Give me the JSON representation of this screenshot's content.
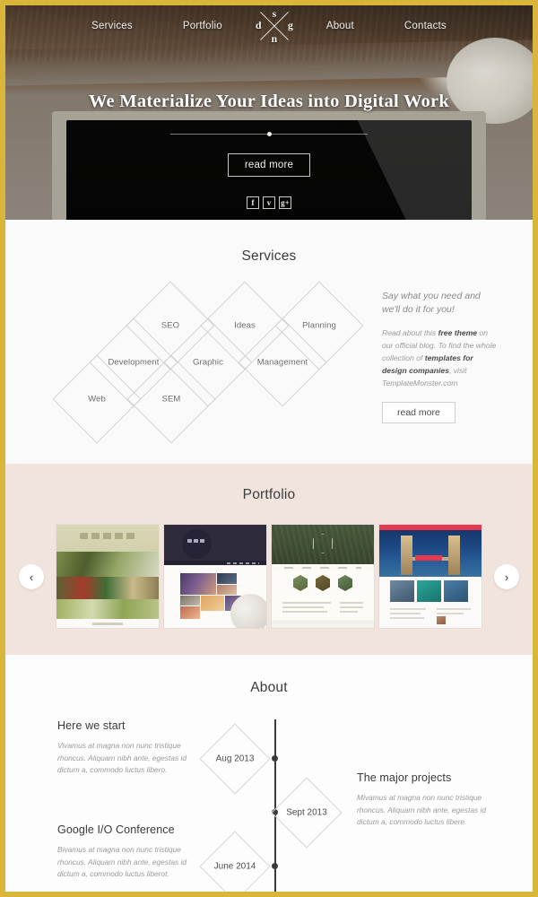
{
  "theme": {
    "frame_color": "#d9b63a",
    "portfolio_bg": "#f1e4dd",
    "page_bg": "#fbfafa",
    "accent_text": "#3c3c3c"
  },
  "nav": {
    "items": [
      {
        "label": "Services"
      },
      {
        "label": "Portfolio"
      },
      {
        "label": "About"
      },
      {
        "label": "Contacts"
      }
    ],
    "logo": {
      "letters": {
        "top": "s",
        "left": "d",
        "right": "g",
        "bottom": "n"
      }
    }
  },
  "hero": {
    "title": "We Materialize Your Ideas into Digital Work",
    "read_more": "read more",
    "social": [
      {
        "name": "facebook-icon",
        "glyph": "f"
      },
      {
        "name": "twitter-icon",
        "glyph": "ᴠ"
      },
      {
        "name": "google-plus-icon",
        "glyph": "g+"
      }
    ]
  },
  "services": {
    "title": "Services",
    "diamonds": [
      {
        "label": "SEO"
      },
      {
        "label": "Ideas"
      },
      {
        "label": "Planning"
      },
      {
        "label": "Development"
      },
      {
        "label": "Graphic"
      },
      {
        "label": "Management"
      },
      {
        "label": "Web"
      },
      {
        "label": "SEM"
      }
    ],
    "lead": "Say what you need and we'll do it for you!",
    "body_1": "Read about this ",
    "body_1_bold": "free theme",
    "body_2": " on our official blog.",
    "body_3": "To find the whole collection of ",
    "body_3_bold": "templates for design companies",
    "body_4": ", visit TemplateMonster.com",
    "read_more": "read more"
  },
  "portfolio": {
    "title": "Portfolio",
    "prev_label": "‹",
    "next_label": "›",
    "items": [
      {
        "name": "restaurant-template-thumbnail"
      },
      {
        "name": "agency-dark-template-thumbnail"
      },
      {
        "name": "green-hex-template-thumbnail"
      },
      {
        "name": "travel-london-template-thumbnail"
      }
    ]
  },
  "about": {
    "title": "About",
    "timeline": [
      {
        "date": "Aug 2013",
        "side": "left",
        "heading": "Here we start",
        "text": "Vivamus at magna non nunc tristique rhoncus. Aliquam nibh ante, egestas id dictum a, commodo luctus libero."
      },
      {
        "date": "Sept 2013",
        "side": "right",
        "heading": "The major projects",
        "text": "Mivamus at magna non nunc tristique rhoncus. Aliquam nibh ante, egestas id dictum a, commodo luctus libere."
      },
      {
        "date": "June 2014",
        "side": "left",
        "heading": "Google I/O Conference",
        "text": "Bivamus at magna non nunc tristique rhoncus. Aliquam nibh ante, egestas id dictum a, commodo luctus liberot."
      }
    ]
  }
}
